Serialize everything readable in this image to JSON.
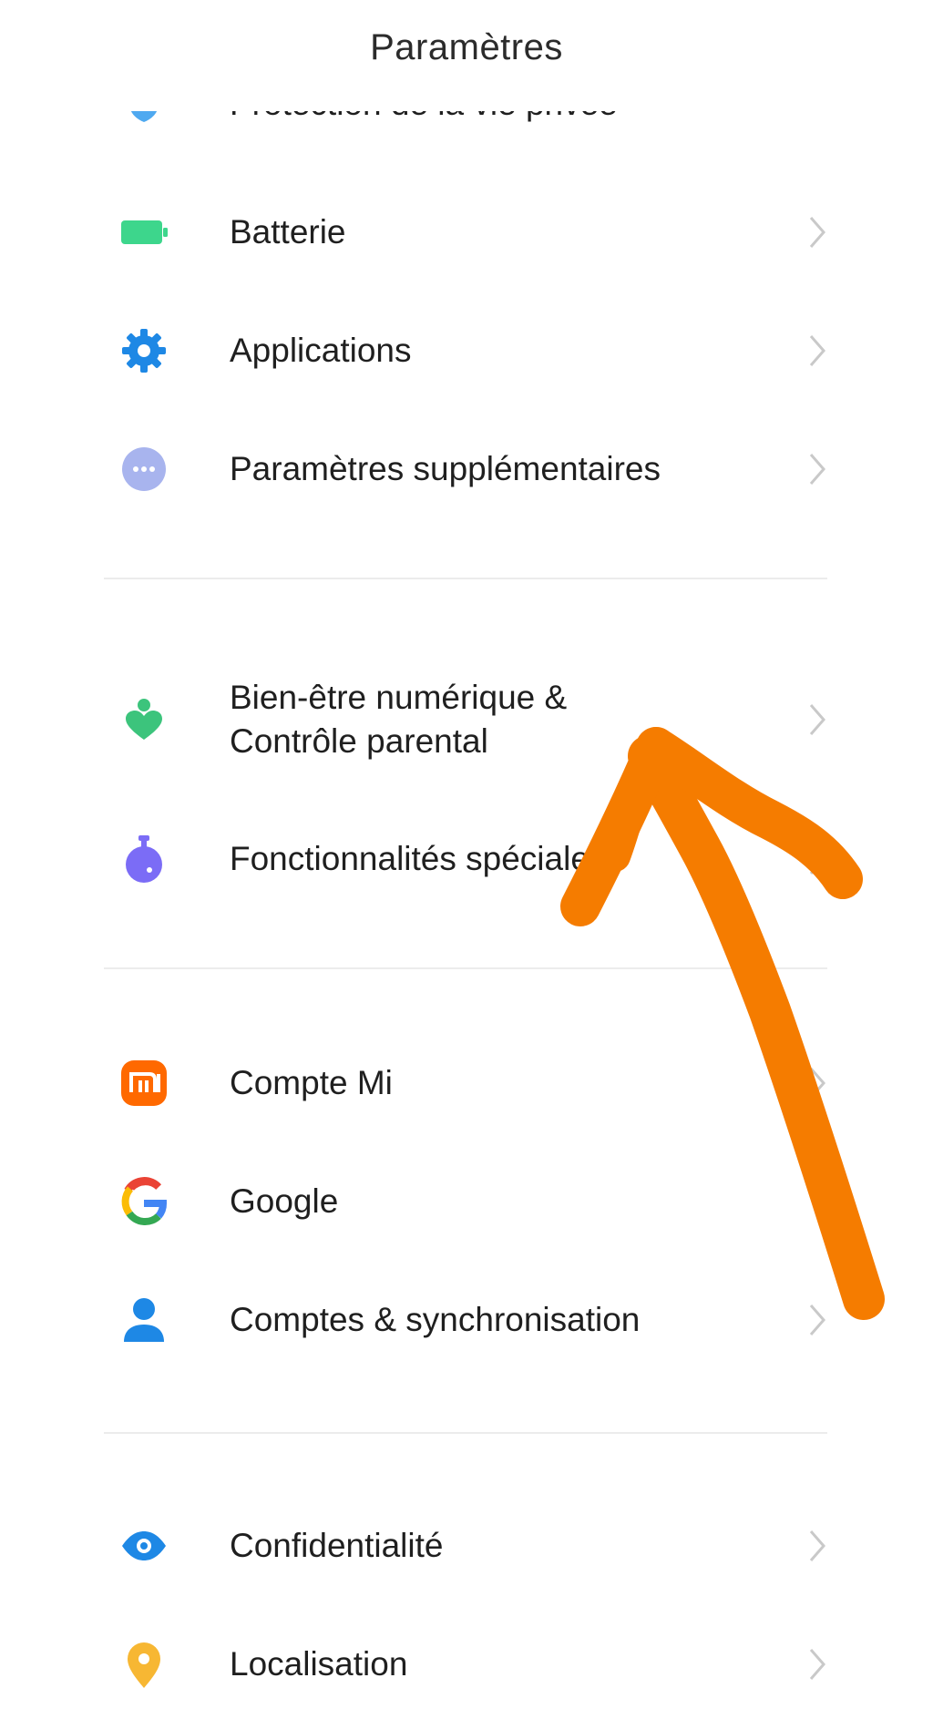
{
  "header": {
    "title": "Paramètres"
  },
  "partial_item": {
    "label": "Protection de la vie privée"
  },
  "items": [
    {
      "label": "Batterie",
      "icon": "battery-icon"
    },
    {
      "label": "Applications",
      "icon": "gear-icon"
    },
    {
      "label": "Paramètres supplémentaires",
      "icon": "more-dots-icon"
    },
    {
      "label_line1": "Bien-être numérique &",
      "label_line2": "Contrôle parental",
      "icon": "digital-wellbeing-icon"
    },
    {
      "label": "Fonctionnalités spéciales",
      "icon": "special-features-icon"
    },
    {
      "label": "Compte Mi",
      "icon": "mi-account-icon"
    },
    {
      "label": "Google",
      "icon": "google-icon"
    },
    {
      "label": "Comptes & synchronisation",
      "icon": "person-icon"
    },
    {
      "label": "Confidentialité",
      "icon": "eye-icon"
    },
    {
      "label": "Localisation",
      "icon": "location-pin-icon"
    }
  ],
  "colors": {
    "accent_blue": "#1E88E5",
    "battery_green": "#3DD68C",
    "wellbeing_green": "#3CC47C",
    "mi_orange": "#FF6900",
    "lavender": "#A8B4EE",
    "special_purple": "#7B6CF6",
    "location_yellow": "#F7B733",
    "annotation_orange": "#F57C00"
  }
}
